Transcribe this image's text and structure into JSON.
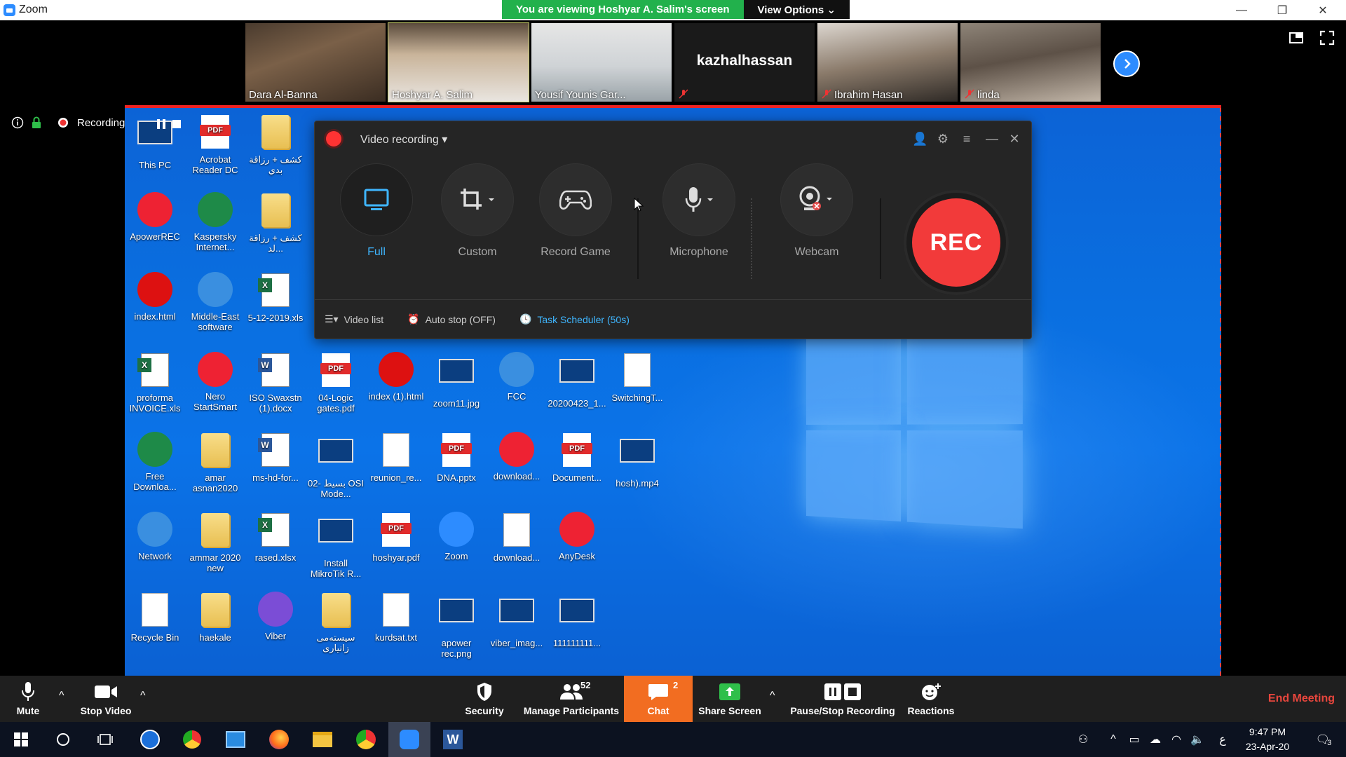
{
  "window": {
    "title": "Zoom",
    "banner": "You are viewing Hoshyar A. Salim's screen",
    "view_options": "View Options"
  },
  "gallery": [
    {
      "name": "Dara Al-Banna",
      "video": true,
      "muted": false
    },
    {
      "name": "Hoshyar A. Salim",
      "video": true,
      "muted": false,
      "active": true
    },
    {
      "name": "Yousif Younis Gar...",
      "video": true,
      "muted": false
    },
    {
      "name": "",
      "display_name": "kazhalhassan",
      "video": false,
      "muted": true
    },
    {
      "name": "Ibrahim Hasan",
      "video": true,
      "muted": true
    },
    {
      "name": "linda",
      "video": true,
      "muted": true
    }
  ],
  "recording_status": "Recording...",
  "desktop_icons": [
    {
      "label": "This PC"
    },
    {
      "label": "Acrobat Reader DC"
    },
    {
      "label": "كشف + رزاقة بدي"
    },
    {
      "label": "ApowerREC"
    },
    {
      "label": "Kaspersky Internet..."
    },
    {
      "label": "كشف + رزاقة لد..."
    },
    {
      "label": "index.html"
    },
    {
      "label": "Middle-East software"
    },
    {
      "label": "5-12-2019.xls"
    },
    {
      "label": "proforma INVOICE.xls"
    },
    {
      "label": "Nero StartSmart"
    },
    {
      "label": "ISO Swaxstn (1).docx"
    },
    {
      "label": "04-Logic gates.pdf"
    },
    {
      "label": "index (1).html"
    },
    {
      "label": "zoom11.jpg"
    },
    {
      "label": "FCC"
    },
    {
      "label": "20200423_1..."
    },
    {
      "label": "SwitchingT..."
    },
    {
      "label": "Free Downloa..."
    },
    {
      "label": "amar asnan2020"
    },
    {
      "label": "ms-hd-for..."
    },
    {
      "label": "02- بسيط OSI Mode..."
    },
    {
      "label": "reunion_re..."
    },
    {
      "label": "DNA.pptx"
    },
    {
      "label": "download..."
    },
    {
      "label": "Document..."
    },
    {
      "label": "hosh).mp4"
    },
    {
      "label": "Network"
    },
    {
      "label": "ammar 2020 new"
    },
    {
      "label": "rased.xlsx"
    },
    {
      "label": "Install MikroTik R..."
    },
    {
      "label": "hoshyar.pdf"
    },
    {
      "label": "Zoom"
    },
    {
      "label": "download..."
    },
    {
      "label": "AnyDesk"
    },
    {
      "label": "Recycle Bin"
    },
    {
      "label": "haekale"
    },
    {
      "label": "Viber"
    },
    {
      "label": "سيستەمی زانیاری"
    },
    {
      "label": "kurdsat.txt"
    },
    {
      "label": "apower rec.png"
    },
    {
      "label": "viber_imag..."
    },
    {
      "label": "111111111..."
    }
  ],
  "recorder": {
    "title": "Video recording",
    "modes": [
      {
        "label": "Full",
        "selected": true
      },
      {
        "label": "Custom"
      },
      {
        "label": "Record Game"
      },
      {
        "label": "Microphone"
      },
      {
        "label": "Webcam"
      }
    ],
    "rec_label": "REC",
    "footer": {
      "video_list": "Video list",
      "auto_stop": "Auto stop (OFF)",
      "task_scheduler": "Task Scheduler (50s)"
    }
  },
  "controls": {
    "mute": "Mute",
    "stop_video": "Stop Video",
    "security": "Security",
    "participants": "Manage Participants",
    "participant_count": "52",
    "chat": "Chat",
    "chat_count": "2",
    "share_screen": "Share Screen",
    "record": "Pause/Stop Recording",
    "reactions": "Reactions",
    "end_meeting": "End Meeting"
  },
  "taskbar": {
    "time": "9:47 PM",
    "date": "23-Apr-20",
    "notifications": "3",
    "lang": "ع"
  },
  "colors": {
    "zoom_blue": "#2d8cff",
    "banner_green": "#22b14c",
    "end_red": "#e8463d",
    "chat_orange": "#f26d21",
    "rec_red": "#f23a3a",
    "scheduler_blue": "#3fb6ff"
  }
}
